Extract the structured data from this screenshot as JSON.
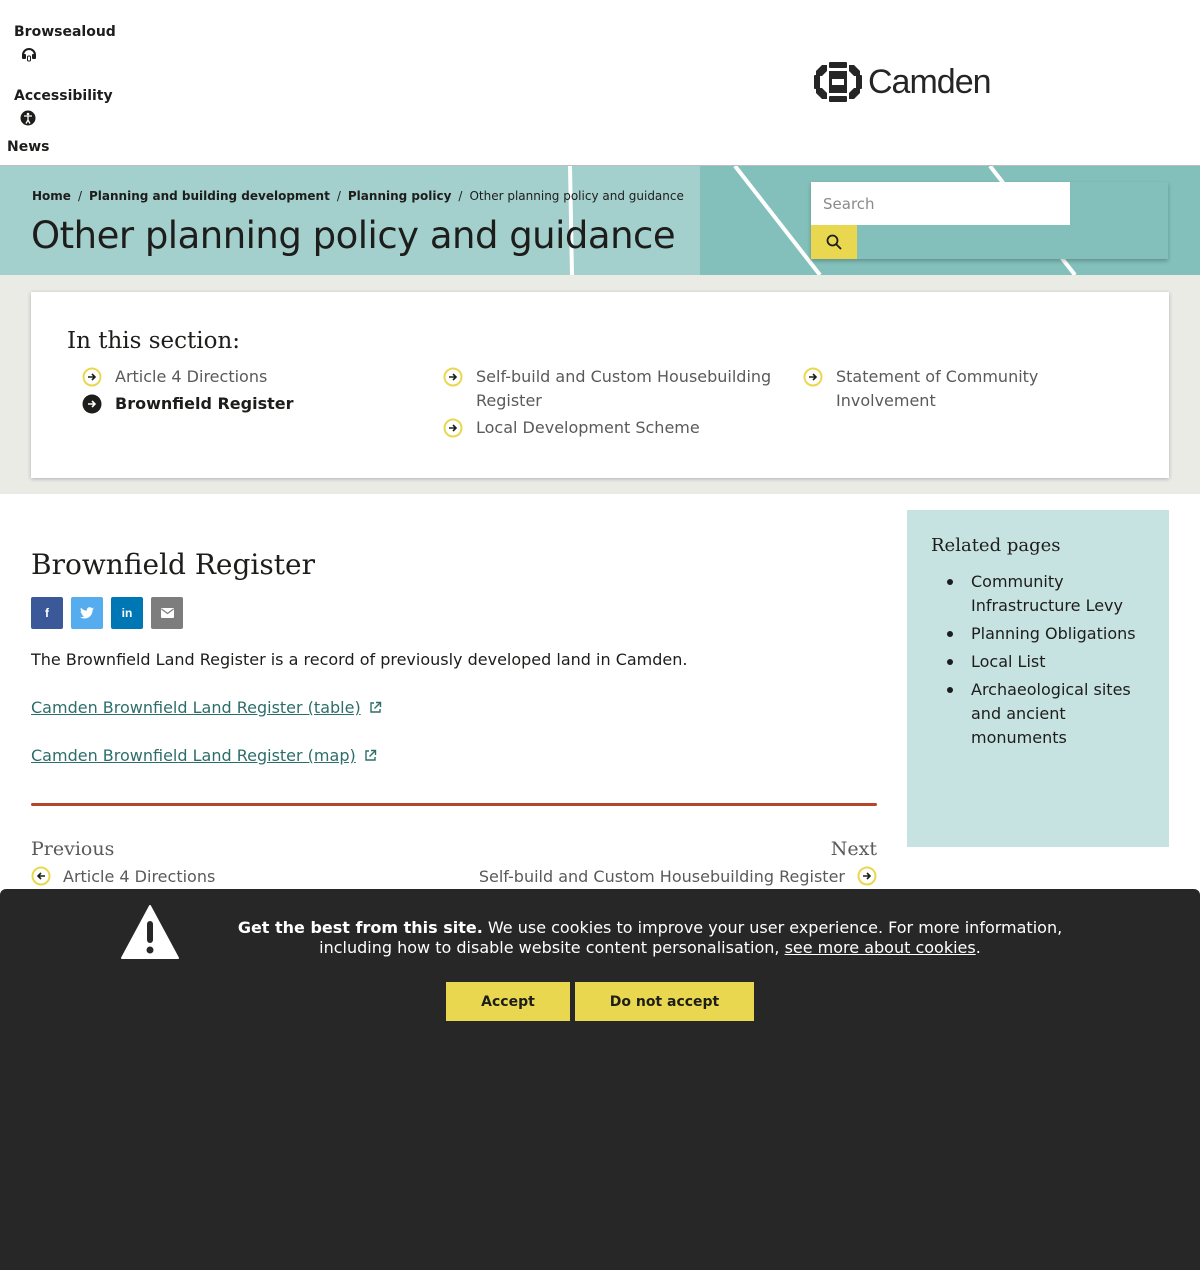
{
  "header": {
    "browsealoud_label": "Browsealoud",
    "accessibility_label": "Accessibility",
    "news_label": "News",
    "logo_text": "Camden"
  },
  "breadcrumb": {
    "items": [
      "Home",
      "Planning and building development",
      "Planning policy"
    ],
    "separator": "/",
    "current": "Other planning policy and guidance"
  },
  "page_title": "Other planning policy and guidance",
  "search": {
    "placeholder": "Search",
    "button_icon": "search-icon"
  },
  "section_nav": {
    "heading": "In this section:",
    "items": [
      {
        "label": "Article 4 Directions",
        "current": false
      },
      {
        "label": "Brownfield Register",
        "current": true
      },
      {
        "label": "Self-build and Custom Housebuilding Register",
        "current": false
      },
      {
        "label": "Local Development Scheme",
        "current": false
      },
      {
        "label": "Statement of Community Involvement",
        "current": false
      }
    ]
  },
  "content": {
    "title": "Brownfield Register",
    "share_buttons": [
      {
        "icon": "facebook-icon",
        "glyph": "f",
        "color": "#3b5998"
      },
      {
        "icon": "twitter-icon",
        "glyph": "🐦",
        "color": "#55acee"
      },
      {
        "icon": "linkedin-icon",
        "glyph": "in",
        "color": "#0077b5"
      },
      {
        "icon": "email-icon",
        "glyph": "✉",
        "color": "#7d7d7d"
      }
    ],
    "intro": "The Brownfield Land Register is a record of previously developed land in Camden.",
    "links": [
      "Camden Brownfield Land Register (table)",
      "Camden Brownfield Land Register (map)"
    ]
  },
  "pagination": {
    "previous_label": "Previous",
    "previous_link": "Article 4 Directions",
    "next_label": "Next",
    "next_link": "Self-build and Custom Housebuilding Register"
  },
  "related": {
    "title": "Related pages",
    "items": [
      "Community Infrastructure Levy",
      "Planning Obligations",
      "Local List",
      "Archaeological sites and ancient monuments"
    ]
  },
  "cookie": {
    "bold_text": "Get the best from this site.",
    "text": " We use cookies to improve your user experience. For more information, including how to disable website content personalisation, ",
    "link_text": "see more about cookies",
    "end": ".",
    "accept_label": "Accept",
    "decline_label": "Do not accept"
  },
  "colors": {
    "accent_yellow": "#e9d84f",
    "teal": "#83c0bb",
    "link": "#2d6e6a",
    "rule": "#b5462b",
    "banner": "#282727"
  }
}
